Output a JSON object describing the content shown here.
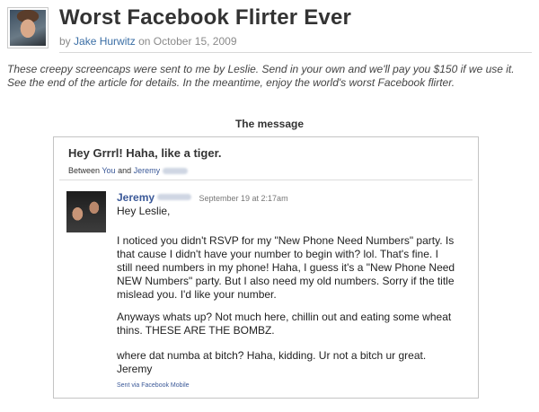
{
  "article": {
    "title": "Worst Facebook Flirter Ever",
    "byline_prefix": "by",
    "author": "Jake Hurwitz",
    "byline_on": "on",
    "date": "October 15, 2009",
    "intro": "These creepy screencaps were sent to me by Leslie. Send in your own and we'll pay you $150 if we use it.  See the end of the article for details.  In the meantime, enjoy the world's worst Facebook flirter.",
    "section_label": "The message"
  },
  "message": {
    "subject": "Hey Grrrl! Haha, like a tiger.",
    "between_prefix": "Between",
    "between_you": "You",
    "between_and": "and",
    "between_other": "Jeremy",
    "sender_name": "Jeremy",
    "sent_at": "September 19 at 2:17am",
    "greeting": "Hey Leslie,",
    "paragraph_1": "I noticed you didn't RSVP for my \"New Phone Need Numbers\" party. Is\nthat cause I didn't have your number to begin with? lol. That's fine. I\nstill need numbers in my phone! Haha, I guess it's a \"New Phone Need\nNEW Numbers\" party. But I also need my old numbers. Sorry if the title\nmislead you. I'd like your number.",
    "paragraph_2": "Anyways whats up? Not much here, chillin out and eating some wheat\nthins. THESE ARE THE BOMBZ.",
    "paragraph_3": "where dat numba at bitch? Haha, kidding. Ur not a bitch ur great.\nJeremy",
    "sent_via": "Sent via Facebook Mobile"
  },
  "colors": {
    "link_blue": "#3a6ea5",
    "facebook_blue": "#3b5998",
    "border": "#c4c4c4"
  }
}
